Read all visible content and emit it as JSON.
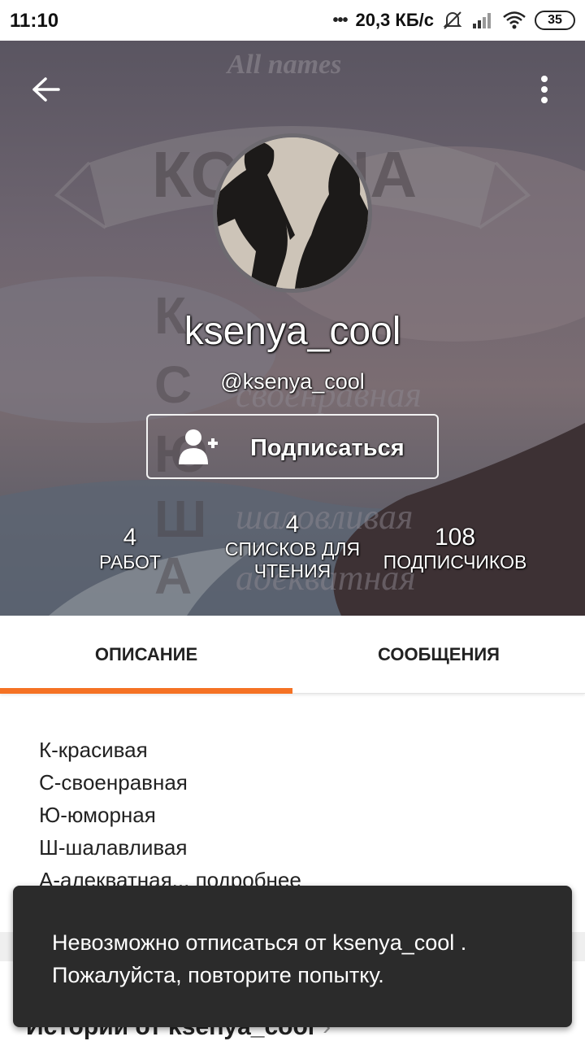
{
  "status_bar": {
    "time": "11:10",
    "network_speed": "20,3 КБ/с",
    "battery": "35",
    "icons": [
      "mute-bell-icon",
      "signal-icon",
      "wifi-icon",
      "battery-icon"
    ]
  },
  "header": {
    "back_icon": "arrow-left-icon",
    "menu_icon": "more-vertical-icon",
    "display_name": "ksenya_cool",
    "username": "@ksenya_cool",
    "follow_button": {
      "label": "Подписаться",
      "icon": "add-user-icon"
    },
    "stats": {
      "works": {
        "value": "4",
        "label": "РАБОТ"
      },
      "reading_lists": {
        "value": "4",
        "label_line1": "СПИСКОВ ДЛЯ",
        "label_line2": "ЧТЕНИЯ"
      },
      "followers": {
        "value": "108",
        "label": "ПОДПИСЧИКОВ"
      }
    }
  },
  "tabs": [
    {
      "label": "ОПИСАНИЕ",
      "active": true
    },
    {
      "label": "СООБЩЕНИЯ",
      "active": false
    }
  ],
  "description": {
    "lines": [
      "К-красивая",
      "С-своенравная",
      "Ю-юморная",
      "Ш-шалавливая"
    ],
    "last_line": "А-алекватная...",
    "more_label": "подробнее"
  },
  "stories": {
    "title": "Истории от ksenya_cool",
    "chevron_icon": "chevron-right-icon"
  },
  "toast": {
    "line1": "Невозможно отписаться от ksenya_cool .",
    "line2": "Пожалуйста, повторите попытку."
  },
  "colors": {
    "accent": "#f57224",
    "toast_bg": "#2b2b2b"
  }
}
